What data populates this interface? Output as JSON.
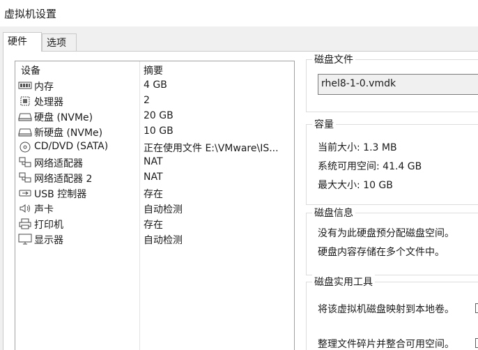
{
  "window": {
    "title": "虚拟机设置"
  },
  "tabs": [
    {
      "label": "硬件",
      "active": true
    },
    {
      "label": "选项",
      "active": false
    }
  ],
  "device_list": {
    "columns": {
      "device": "设备",
      "summary": "摘要"
    },
    "rows": [
      {
        "icon": "memory-icon",
        "name": "内存",
        "summary": "4 GB"
      },
      {
        "icon": "processor-icon",
        "name": "处理器",
        "summary": "2"
      },
      {
        "icon": "hard-disk-icon",
        "name": "硬盘 (NVMe)",
        "summary": "20 GB"
      },
      {
        "icon": "hard-disk-icon",
        "name": "新硬盘 (NVMe)",
        "summary": "10 GB"
      },
      {
        "icon": "cd-dvd-icon",
        "name": "CD/DVD (SATA)",
        "summary": "正在使用文件 E:\\VMware\\IS..."
      },
      {
        "icon": "network-adapter-icon",
        "name": "网络适配器",
        "summary": "NAT"
      },
      {
        "icon": "network-adapter-icon",
        "name": "网络适配器 2",
        "summary": "NAT"
      },
      {
        "icon": "usb-icon",
        "name": "USB 控制器",
        "summary": "存在"
      },
      {
        "icon": "sound-card-icon",
        "name": "声卡",
        "summary": "自动检测"
      },
      {
        "icon": "printer-icon",
        "name": "打印机",
        "summary": "存在"
      },
      {
        "icon": "display-icon",
        "name": "显示器",
        "summary": "自动检测"
      }
    ]
  },
  "disk_file": {
    "legend": "磁盘文件",
    "value": "rhel8-1-0.vmdk"
  },
  "capacity": {
    "legend": "容量",
    "current_size": "当前大小: 1.3 MB",
    "available_space": "系统可用空间: 41.4 GB",
    "max_size": "最大大小: 10 GB"
  },
  "disk_info": {
    "legend": "磁盘信息",
    "line1": "没有为此硬盘预分配磁盘空间。",
    "line2": "硬盘内容存储在多个文件中。"
  },
  "disk_utilities": {
    "legend": "磁盘实用工具",
    "map": "将该虚拟机磁盘映射到本地卷。",
    "defrag": "整理文件碎片并整合可用空间。"
  }
}
